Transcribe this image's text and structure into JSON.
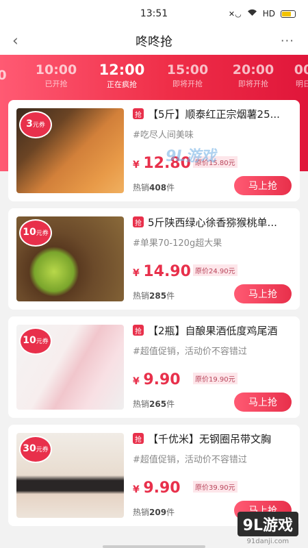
{
  "status": {
    "time": "13:51",
    "network": "HD"
  },
  "nav": {
    "title": "咚咚抢"
  },
  "time_tabs": [
    {
      "time": "0",
      "state": ""
    },
    {
      "time": "10:00",
      "state": "已开抢"
    },
    {
      "time": "12:00",
      "state": "正在疯抢"
    },
    {
      "time": "15:00",
      "state": "即将开抢"
    },
    {
      "time": "20:00",
      "state": "即将开抢"
    },
    {
      "time": "00",
      "state": "明日"
    }
  ],
  "products": [
    {
      "coupon_num": "3",
      "coupon_unit": "元券",
      "tag": "抢",
      "title": "【5斤】顺泰红正宗烟薯25...",
      "subtitle": "#吃尽人间美味",
      "currency": "¥",
      "price": "12.80",
      "original_price": "原价15.80元",
      "sold_label": "热销",
      "sold_count": "408",
      "sold_unit": "件",
      "button": "马上抢"
    },
    {
      "coupon_num": "10",
      "coupon_unit": "元券",
      "tag": "抢",
      "title": "5斤陕西绿心徐香猕猴桃单...",
      "subtitle": "#单果70-120g超大果",
      "currency": "¥",
      "price": "14.90",
      "original_price": "原价24.90元",
      "sold_label": "热销",
      "sold_count": "285",
      "sold_unit": "件",
      "button": "马上抢"
    },
    {
      "coupon_num": "10",
      "coupon_unit": "元券",
      "tag": "抢",
      "title": "【2瓶】自酿果酒低度鸡尾酒",
      "subtitle": "#超值促销，活动价不容错过",
      "currency": "¥",
      "price": "9.90",
      "original_price": "原价19.90元",
      "sold_label": "热销",
      "sold_count": "265",
      "sold_unit": "件",
      "button": "马上抢"
    },
    {
      "coupon_num": "30",
      "coupon_unit": "元券",
      "tag": "抢",
      "title": "【千优米】无钢圈吊带文胸",
      "subtitle": "#超值促销，活动价不容错过",
      "currency": "¥",
      "price": "9.90",
      "original_price": "原价39.90元",
      "sold_label": "热销",
      "sold_count": "209",
      "sold_unit": "件",
      "button": "马上抢"
    }
  ],
  "watermark": {
    "mid": "9L游戏",
    "main": "9L游戏",
    "sub": "91danji.com"
  },
  "colors": {
    "accent": "#e8304b",
    "hero_start": "#ff5a73",
    "hero_end": "#e0163a"
  },
  "icons": [
    "back-arrow-icon",
    "more-dots-icon",
    "wifi-icon",
    "signal-icon",
    "battery-icon"
  ]
}
